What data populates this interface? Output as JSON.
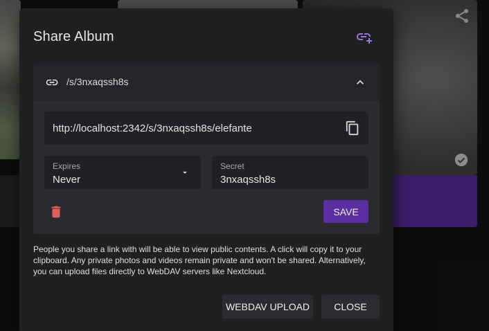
{
  "dialog": {
    "title": "Share Album"
  },
  "link_panel": {
    "path": "/s/3nxaqssh8s",
    "url": "http://localhost:2342/s/3nxaqssh8s/elefante",
    "expires": {
      "label": "Expires",
      "value": "Never"
    },
    "secret": {
      "label": "Secret",
      "value": "3nxaqssh8s"
    },
    "save_label": "SAVE"
  },
  "info_text": "People you share a link with will be able to view public contents. A click will copy it to your clipboard. Any private photos and videos remain private and won't be shared. Alternatively, you can upload files directly to WebDAV servers like Nextcloud.",
  "actions": {
    "webdav_label": "WEBDAV UPLOAD",
    "close_label": "CLOSE"
  },
  "colors": {
    "accent": "#5b2fa1",
    "add_icon": "#9a7ae0",
    "delete": "#e0605a"
  },
  "icons": {
    "add_link": "add-link-icon",
    "link": "link-icon",
    "collapse": "chevron-up-icon",
    "copy": "copy-icon",
    "dropdown": "dropdown-arrow-icon",
    "delete": "trash-icon",
    "background_share": "share-icon",
    "background_check": "check-circle-icon"
  }
}
